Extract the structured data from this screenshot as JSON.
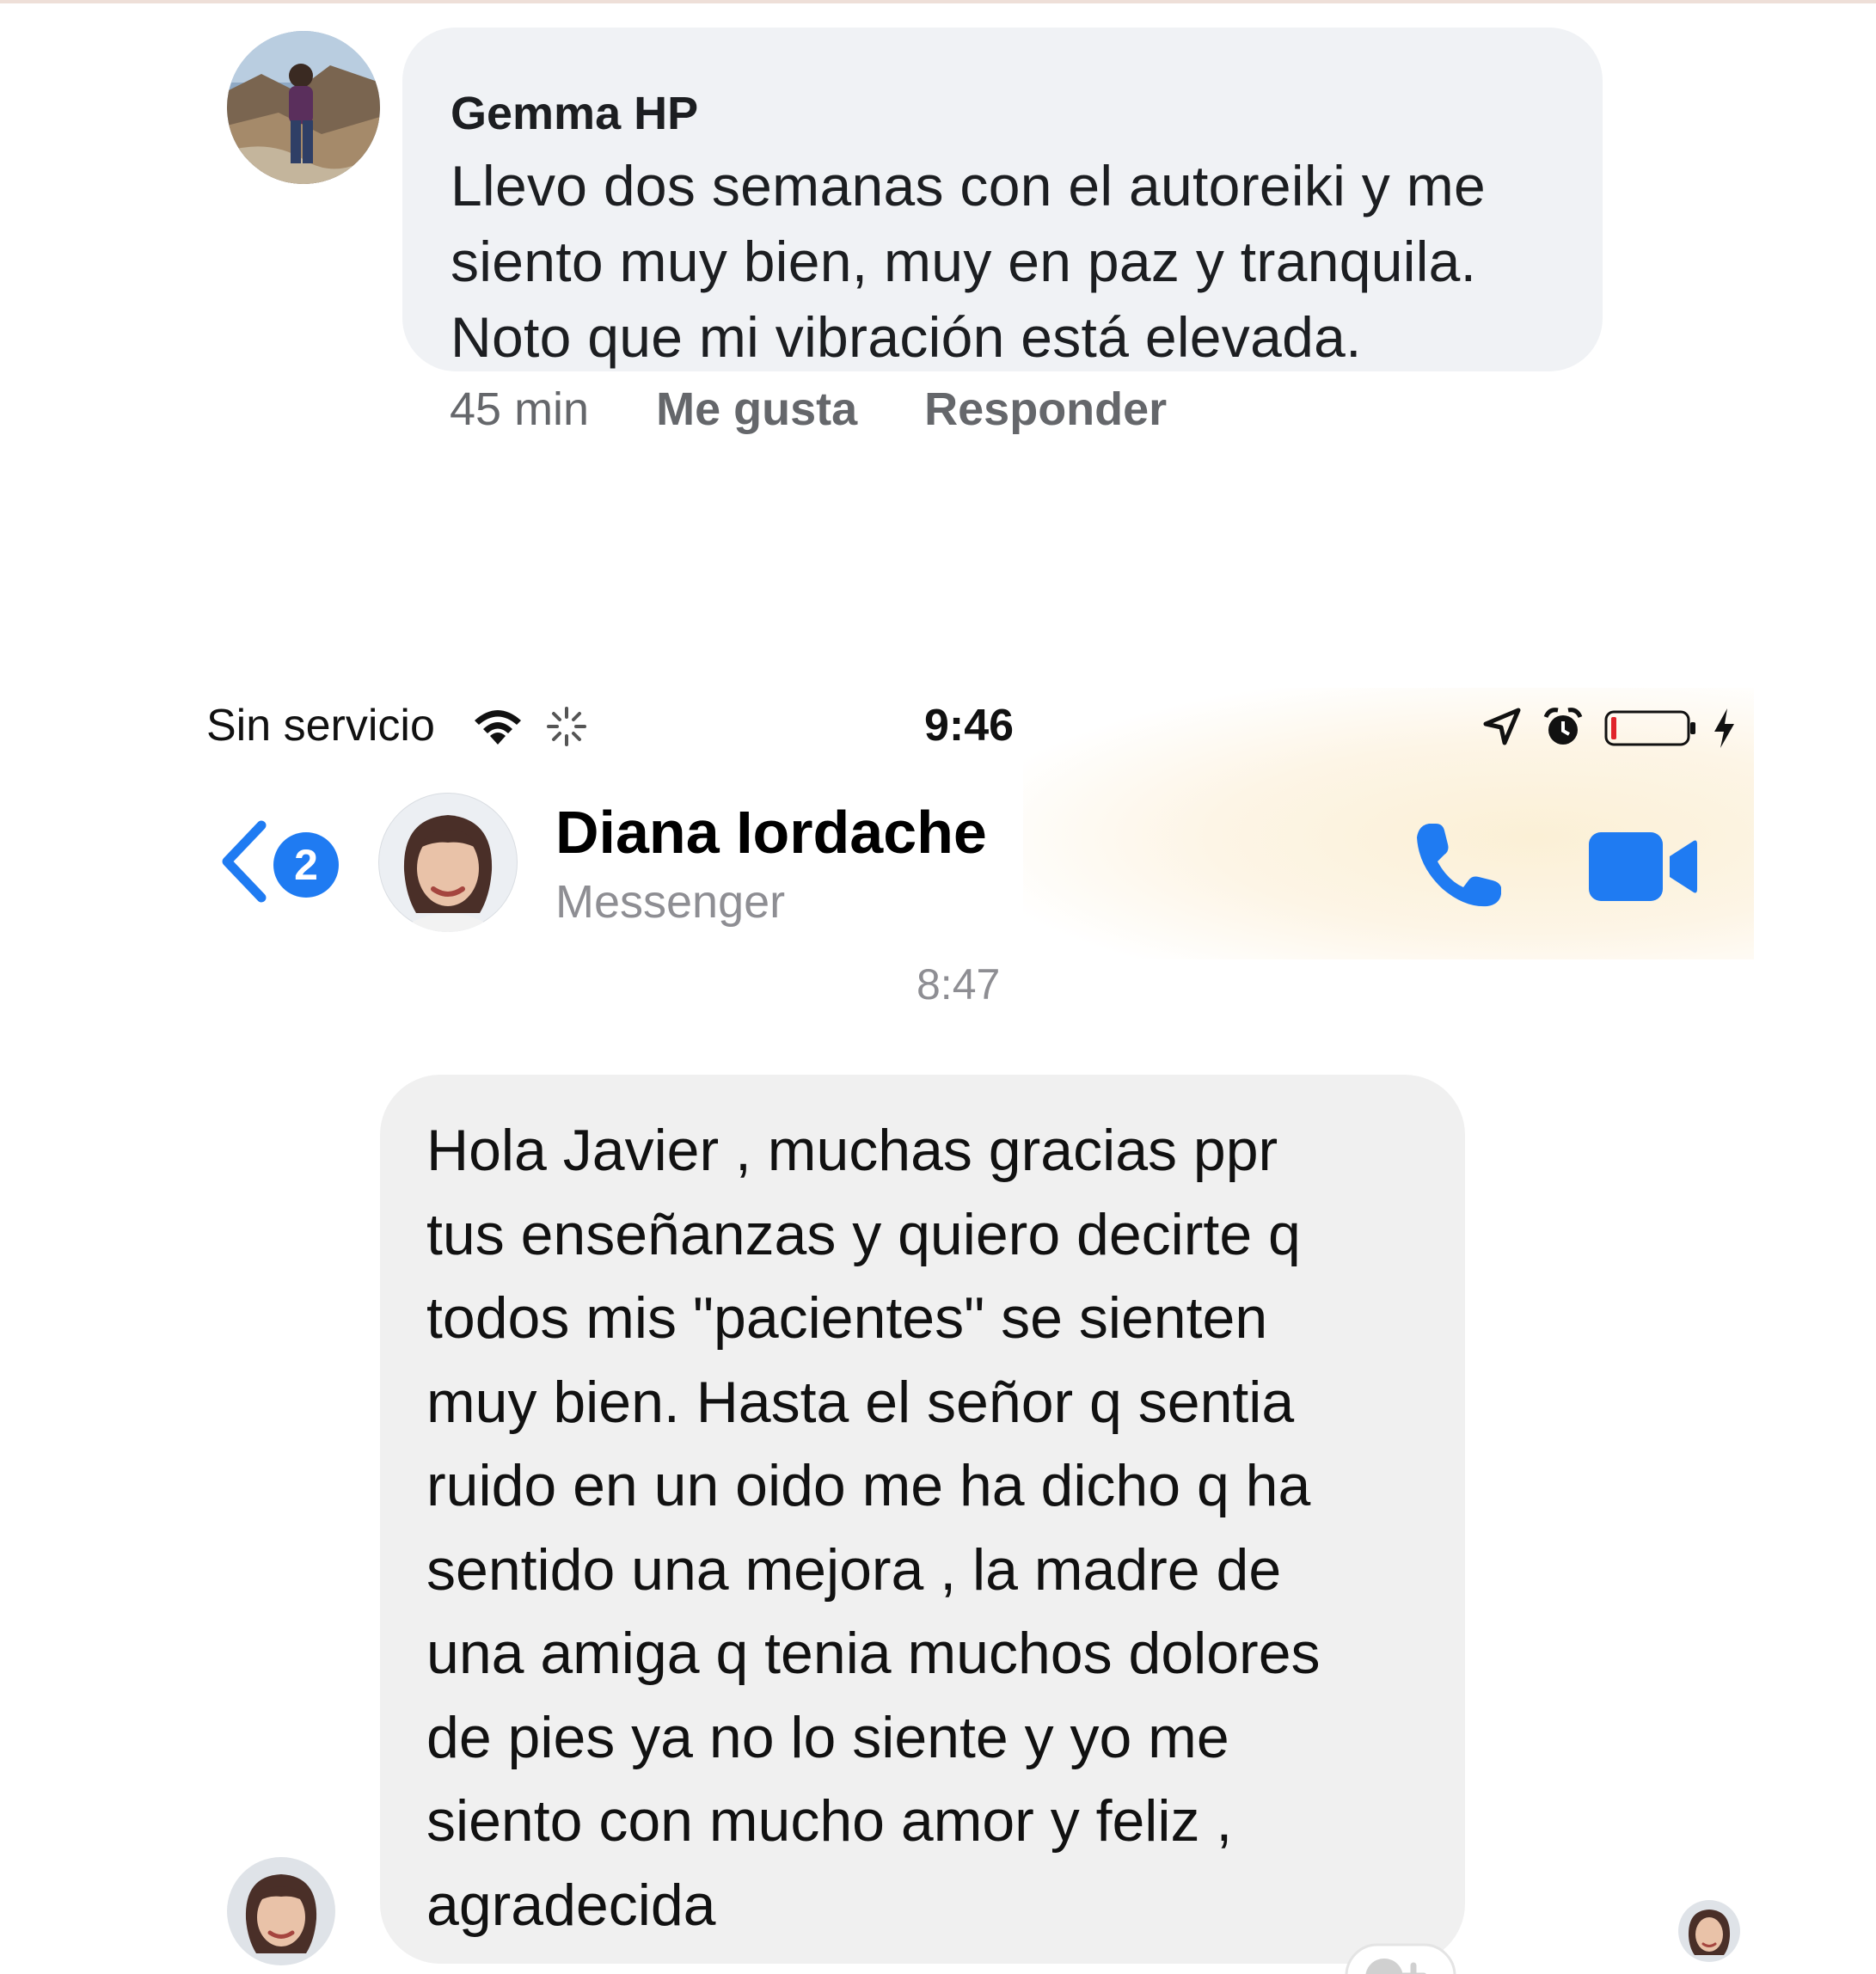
{
  "comment": {
    "author": "Gemma HP",
    "text": "Llevo dos semanas con el autoreiki y me siento muy bien, muy en paz y tranquila. Noto que mi vibración está elevada.",
    "time": "45 min",
    "like_label": "Me gusta",
    "reply_label": "Responder"
  },
  "status_bar": {
    "carrier": "Sin servicio",
    "time": "9:46"
  },
  "chat_header": {
    "unread_count": "2",
    "contact_name": "Diana Iordache",
    "subtitle": "Messenger",
    "accent_color": "#1f7bf2"
  },
  "conversation": {
    "timestamp": "8:47",
    "message": "Hola Javier , muchas gracias ppr\ntus enseñanzas y quiero decirte q\ntodos mis \"pacientes\"  se sienten\nmuy bien. Hasta el señor q sentia\nruido en un oido me ha dicho q ha\nsentido una mejora , la madre de\nuna amiga q tenia muchos dolores\nde pies ya no lo siente y yo me\nsiento con mucho amor y feliz ,\nagradecida"
  }
}
